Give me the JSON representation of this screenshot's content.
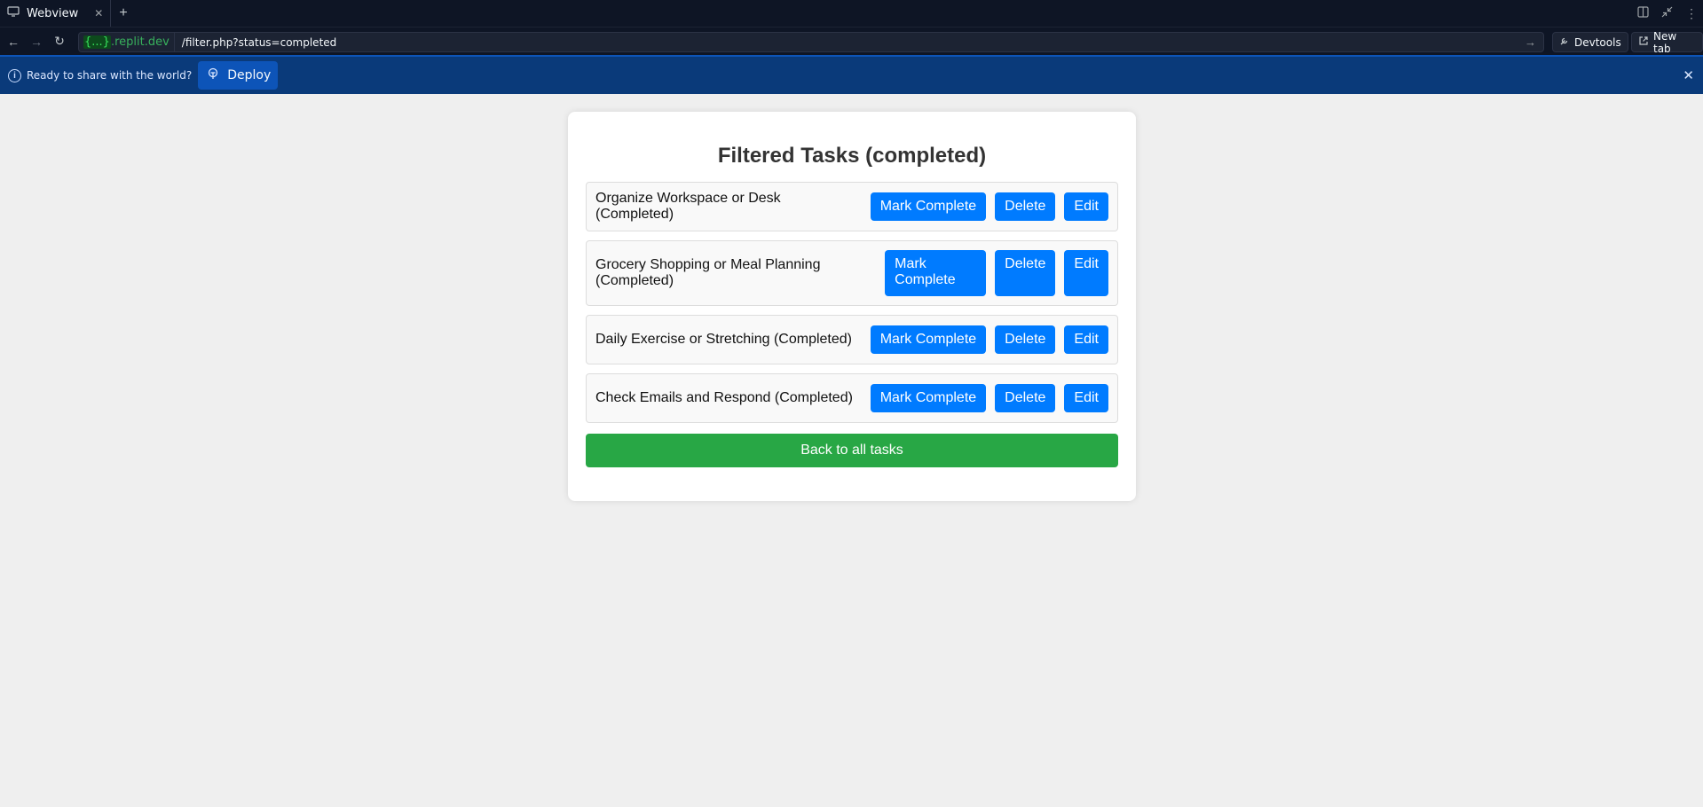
{
  "browser": {
    "tab_title": "Webview",
    "address": {
      "braces": "{...}",
      "host": ".replit.dev",
      "path": "/filter.php?status=completed"
    },
    "devtools_label": "Devtools",
    "newtab_label": "New tab"
  },
  "banner": {
    "message": "Ready to share with the world?",
    "deploy_label": "Deploy"
  },
  "page": {
    "title": "Filtered Tasks (completed)",
    "tasks": [
      {
        "name": "Organize Workspace or Desk (Completed)"
      },
      {
        "name": "Grocery Shopping or Meal Planning (Completed)"
      },
      {
        "name": "Daily Exercise or Stretching (Completed)"
      },
      {
        "name": "Check Emails and Respond (Completed)"
      }
    ],
    "mark_label": "Mark Complete",
    "delete_label": "Delete",
    "edit_label": "Edit",
    "back_label": "Back to all tasks"
  },
  "colors": {
    "primary": "#007bff",
    "success": "#28a745",
    "banner": "#0a3a7a"
  }
}
